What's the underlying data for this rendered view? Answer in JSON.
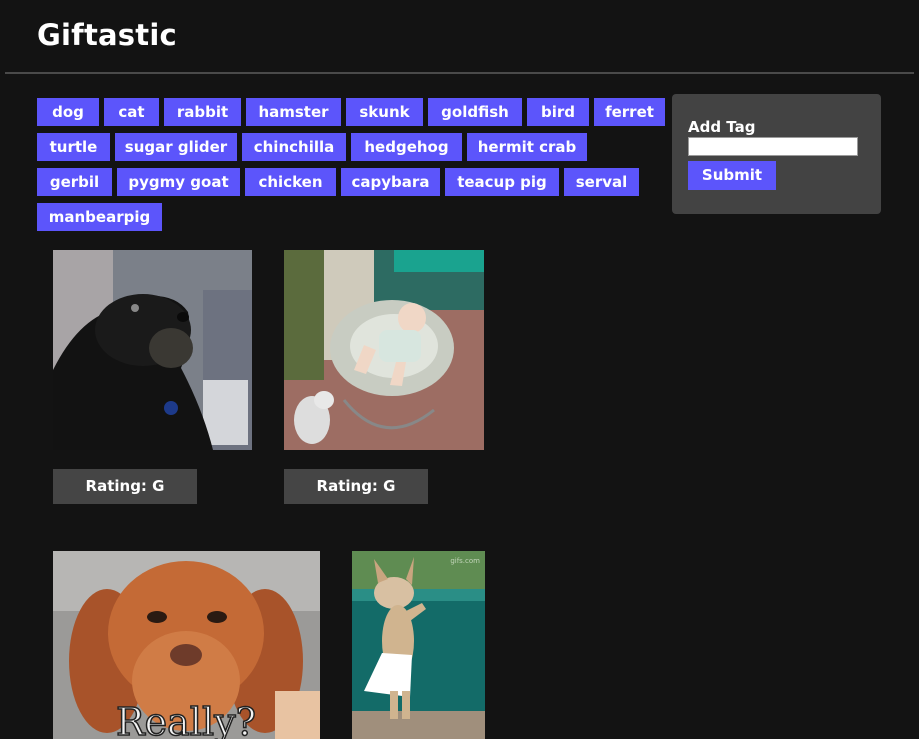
{
  "header": {
    "title": "Giftastic"
  },
  "tags": [
    "dog",
    "cat",
    "rabbit",
    "hamster",
    "skunk",
    "goldfish",
    "bird",
    "ferret",
    "turtle",
    "sugar glider",
    "chinchilla",
    "hedgehog",
    "hermit crab",
    "gerbil",
    "pygmy goat",
    "chicken",
    "capybara",
    "teacup pig",
    "serval",
    "manbearpig"
  ],
  "add_tag": {
    "label": "Add Tag",
    "input_value": "",
    "submit_label": "Submit"
  },
  "gifs": [
    {
      "rating": "Rating: G"
    },
    {
      "rating": "Rating: G"
    },
    {
      "caption": "Really?"
    },
    {
      "watermark": "gifs.com"
    }
  ],
  "colors": {
    "accent": "#5c55fb",
    "background": "#131313",
    "panel": "#434343",
    "rating_bg": "#454545"
  }
}
